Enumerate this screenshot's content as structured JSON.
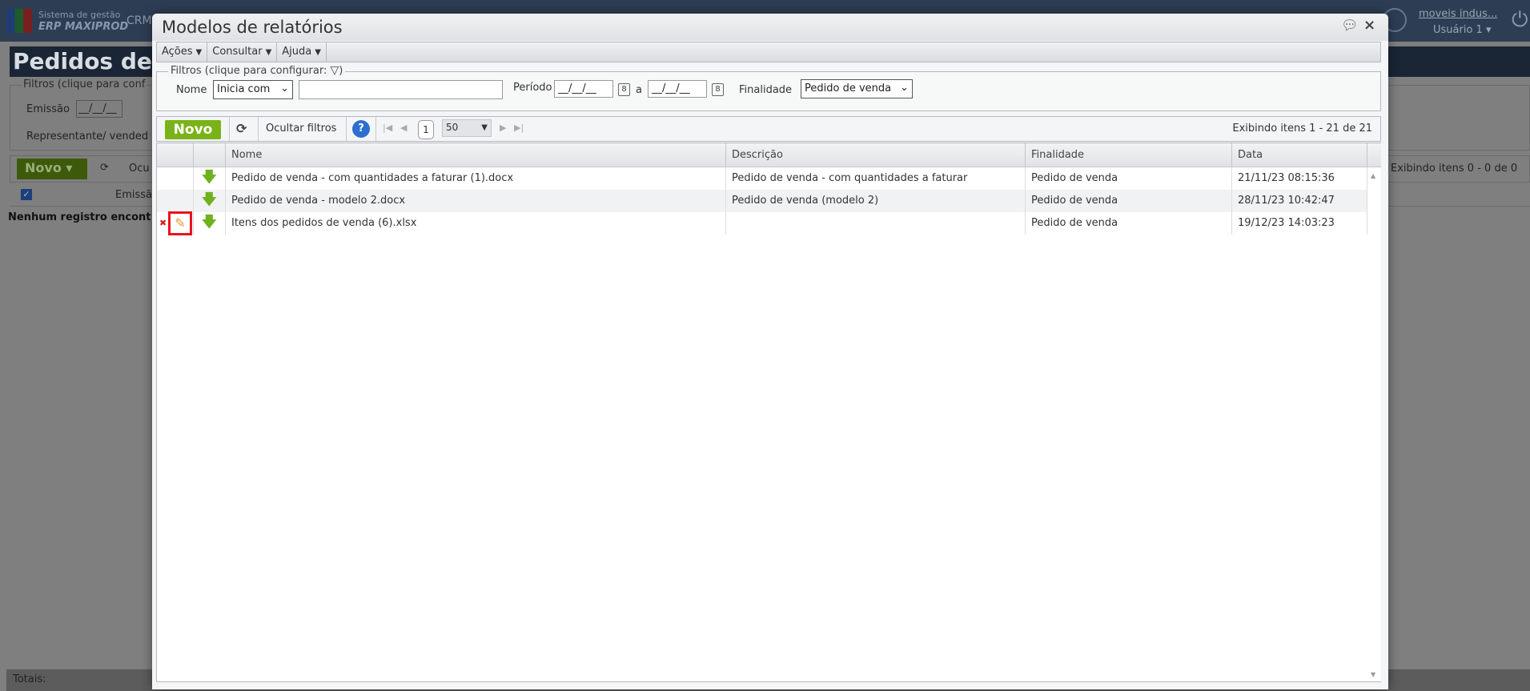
{
  "background": {
    "logo_line1": "Sistema de gestão",
    "logo_line2": "ERP MAXIPROD",
    "crm": "CRM",
    "company_link": "moveis indus...",
    "user": "Usuário 1",
    "page_title": "Pedidos de v",
    "filters_legend": "Filtros (clique para conf",
    "emissao_label": "Emissão",
    "emissao_value": "__/__/__",
    "representante_label": "Representante/ vended",
    "novo_label": "Novo",
    "ocultar_short": "Ocu",
    "col_emissao": "Emissã",
    "empty_message": "Nenhum registro encont",
    "items_count": "Exibindo itens 0 - 0 de 0",
    "totals_label": "Totais:"
  },
  "modal": {
    "title": "Modelos de relatórios",
    "menu": [
      {
        "label": "Ações"
      },
      {
        "label": "Consultar"
      },
      {
        "label": "Ajuda"
      }
    ],
    "filters": {
      "legend": "Filtros (clique para configurar:",
      "legend_close": ")",
      "nome_label": "Nome",
      "nome_operator": "Inicia com",
      "nome_value": "",
      "periodo_label": "Período",
      "periodo_from": "__/__/__",
      "periodo_sep": "a",
      "periodo_to": "__/__/__",
      "finalidade_label": "Finalidade",
      "finalidade_value": "Pedido de venda"
    },
    "toolbar": {
      "novo": "Novo",
      "hide_filters": "Ocultar filtros",
      "page": "1",
      "page_size": "50",
      "items_count": "Exibindo itens 1 - 21 de 21"
    },
    "columns": [
      "Nome",
      "Descrição",
      "Finalidade",
      "Data"
    ],
    "rows": [
      {
        "nome": "Pedido de venda - com quantidades a faturar (1).docx",
        "descricao": "Pedido de venda - com quantidades a faturar",
        "finalidade": "Pedido de venda",
        "data": "21/11/23 08:15:36"
      },
      {
        "nome": "Pedido de venda - modelo 2.docx",
        "descricao": "Pedido de venda (modelo 2)",
        "finalidade": "Pedido de venda",
        "data": "28/11/23 10:42:47"
      },
      {
        "nome": "Itens dos pedidos de venda (6).xlsx",
        "descricao": "",
        "finalidade": "Pedido de venda",
        "data": "19/12/23 14:03:23"
      }
    ],
    "highlight_color": "#e8141c",
    "accent_green": "#7ab317"
  }
}
